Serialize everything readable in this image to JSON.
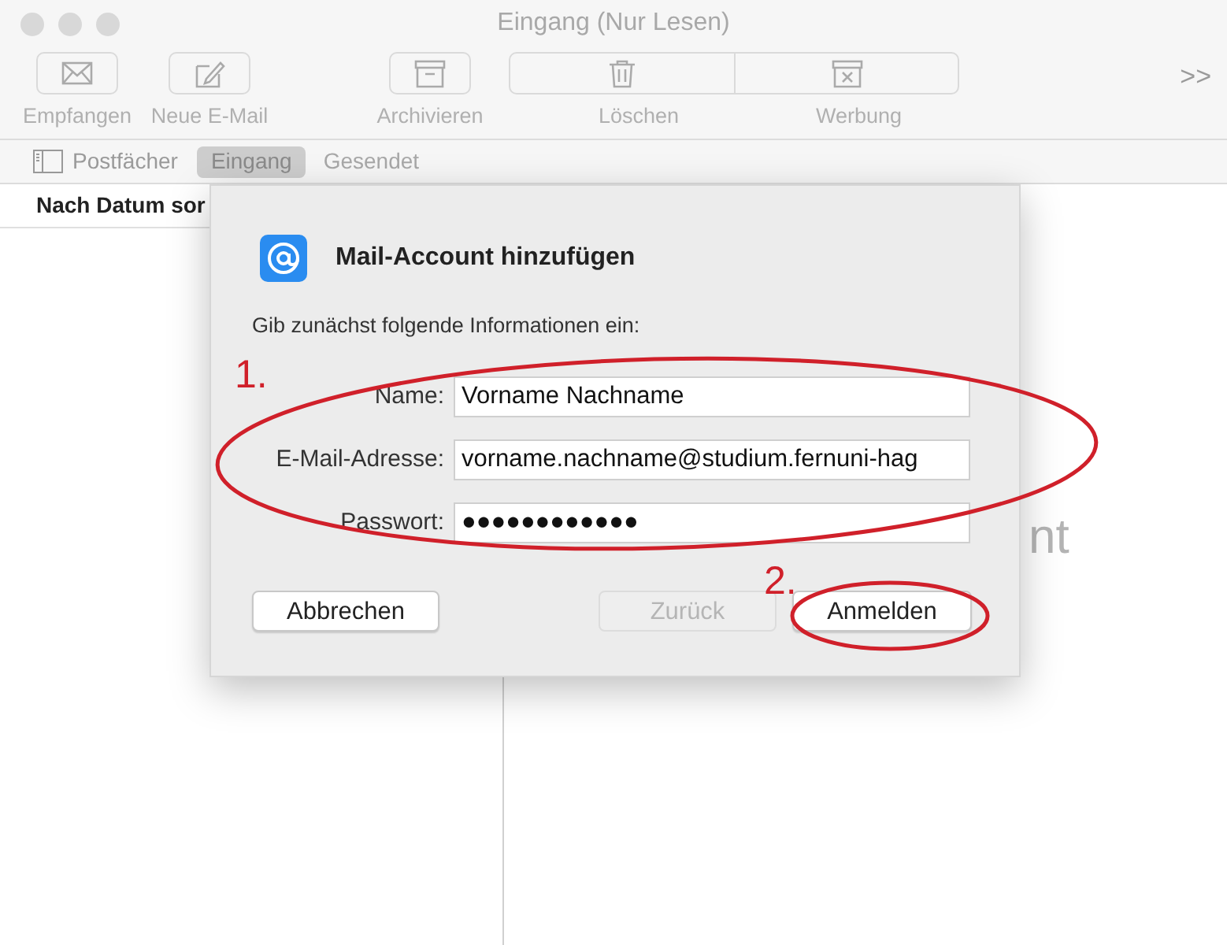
{
  "window": {
    "title": "Eingang (Nur Lesen)"
  },
  "toolbar": {
    "items": [
      {
        "label": "Empfangen",
        "kind": "single",
        "disabled": true
      },
      {
        "label": "Neue E-Mail",
        "kind": "single",
        "disabled": true
      },
      {
        "label": "Archivieren",
        "kind": "single",
        "disabled": true
      },
      {
        "label": "Löschen",
        "kind": "segment",
        "disabled": true
      },
      {
        "label": "Werbung",
        "kind": "segment",
        "disabled": true
      }
    ],
    "overflow": ">>"
  },
  "favorites": [
    {
      "label": "Postfächer",
      "kind": "mailboxes",
      "selected": false
    },
    {
      "label": "Eingang",
      "kind": "tab",
      "selected": true
    },
    {
      "label": "Gesendet",
      "kind": "tab",
      "selected": false
    }
  ],
  "message_list": {
    "sort_label": "Nach Datum sor"
  },
  "preview": {
    "text": "nt"
  },
  "dialog": {
    "title": "Mail-Account hinzufügen",
    "intro": "Gib zunächst folgende Informationen ein:",
    "fields": [
      {
        "label": "Name:",
        "value": "Vorname Nachname"
      },
      {
        "label": "E-Mail-Adresse:",
        "value": "vorname.nachname@studium.fernuni-hag"
      },
      {
        "label": "Passwort:",
        "value": "●●●●●●●●●●●●"
      }
    ],
    "buttons": [
      {
        "label": "Abbrechen",
        "disabled": false
      },
      {
        "label": "Zurück",
        "disabled": true
      },
      {
        "label": "Anmelden",
        "disabled": false
      }
    ]
  },
  "annotations": [
    {
      "label": "1."
    },
    {
      "label": "2."
    }
  ]
}
